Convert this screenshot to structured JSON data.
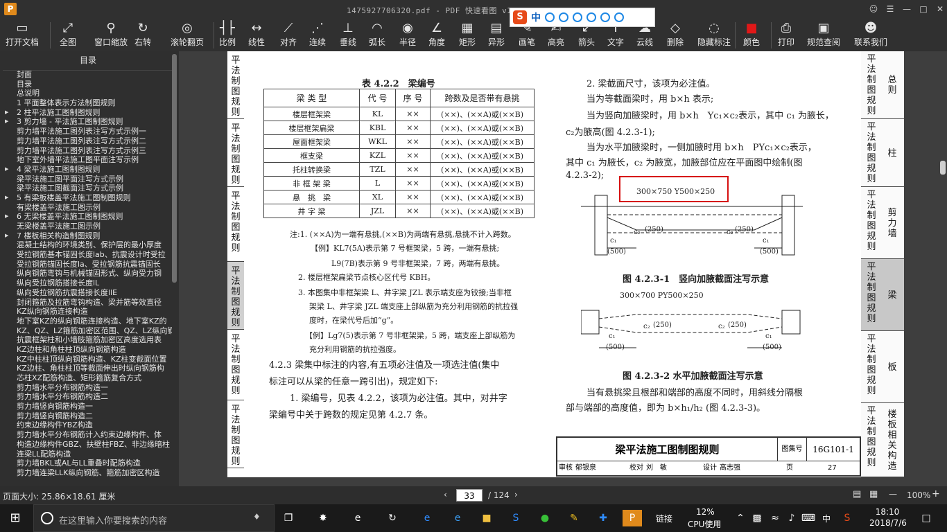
{
  "window": {
    "title": "1475927706320.pdf - PDF 快速看图 v1.8",
    "app_icon": "P"
  },
  "ime": {
    "logo": "S",
    "mode": "中"
  },
  "toolbar": [
    {
      "id": "open",
      "label": "打开文档",
      "icon": "folder-icon"
    },
    {
      "id": "full",
      "label": "全图",
      "icon": "fit-icon"
    },
    {
      "id": "zoomwin",
      "label": "窗口缩放",
      "icon": "zoom-icon"
    },
    {
      "id": "rotate",
      "label": "右转",
      "icon": "rotate-icon"
    },
    {
      "id": "wheel",
      "label": "滚轮翻页",
      "icon": "mouse-icon"
    },
    {
      "id": "ratio",
      "label": "比例",
      "icon": "ruler-icon"
    },
    {
      "id": "linear",
      "label": "线性",
      "icon": "linear-icon"
    },
    {
      "id": "align",
      "label": "对齐",
      "icon": "align-icon"
    },
    {
      "id": "chain",
      "label": "连续",
      "icon": "chain-icon"
    },
    {
      "id": "perp",
      "label": "垂线",
      "icon": "perp-icon"
    },
    {
      "id": "arc",
      "label": "弧长",
      "icon": "arc-icon"
    },
    {
      "id": "radius",
      "label": "半径",
      "icon": "radius-icon"
    },
    {
      "id": "angle",
      "label": "角度",
      "icon": "angle-icon"
    },
    {
      "id": "rect",
      "label": "矩形",
      "icon": "rect-icon"
    },
    {
      "id": "shape",
      "label": "异形",
      "icon": "shape-icon"
    },
    {
      "id": "pen",
      "label": "画笔",
      "icon": "pen-icon"
    },
    {
      "id": "high",
      "label": "高亮",
      "icon": "highlight-icon"
    },
    {
      "id": "arrow",
      "label": "箭头",
      "icon": "arrow-icon"
    },
    {
      "id": "text",
      "label": "文字",
      "icon": "text-icon"
    },
    {
      "id": "cloud",
      "label": "云线",
      "icon": "cloud-icon"
    },
    {
      "id": "del",
      "label": "删除",
      "icon": "eraser-icon"
    },
    {
      "id": "hide",
      "label": "隐藏标注",
      "icon": "eye-off-icon"
    },
    {
      "id": "color",
      "label": "颜色",
      "icon": "color-icon",
      "color": "#e01818"
    },
    {
      "id": "print",
      "label": "打印",
      "icon": "printer-icon"
    },
    {
      "id": "spec",
      "label": "规范查阅",
      "icon": "book-icon"
    },
    {
      "id": "contact",
      "label": "联系我们",
      "icon": "user-icon"
    }
  ],
  "sidebar": {
    "title": "目录",
    "items": [
      {
        "t": "封面",
        "a": false
      },
      {
        "t": "目录",
        "a": false
      },
      {
        "t": "总说明",
        "a": false
      },
      {
        "t": "1 平面整体表示方法制图规则",
        "a": false
      },
      {
        "t": "2 柱平法施工图制图规则",
        "a": true
      },
      {
        "t": "3 剪力墙 - 平法施工图制图规则",
        "a": true
      },
      {
        "t": "剪力墙平法施工图列表注写方式示例一",
        "a": false
      },
      {
        "t": "剪力墙平法施工图列表注写方式示例二",
        "a": false
      },
      {
        "t": "剪力墙平法施工图列表注写方式示例三",
        "a": false
      },
      {
        "t": "地下室外墙平法施工图平面注写示例",
        "a": false
      },
      {
        "t": "4 梁平法施工图制图规则",
        "a": true
      },
      {
        "t": "梁平法施工图平面注写方式示例",
        "a": false
      },
      {
        "t": "梁平法施工图截面注写方式示例",
        "a": false
      },
      {
        "t": "5 有梁板楼盖平法施工图制图规则",
        "a": true
      },
      {
        "t": "有梁楼盖平法施工图示例",
        "a": false
      },
      {
        "t": "6 无梁楼盖平法施工图制图规则",
        "a": true
      },
      {
        "t": "无梁楼盖平法施工图示例",
        "a": false
      },
      {
        "t": "7 楼板相关构造制图规则",
        "a": true
      },
      {
        "t": "混凝土结构的环境类别、保护层的最小厚度",
        "a": false
      },
      {
        "t": "受拉钢筋基本锚固长度lab、抗震设计时受拉",
        "a": false
      },
      {
        "t": "受拉钢筋锚固长度la、受拉钢筋抗震锚固长",
        "a": false
      },
      {
        "t": "纵向钢筋弯钩与机械锚固形式、纵向受力钢",
        "a": false
      },
      {
        "t": "纵向受拉钢筋搭接长度lL",
        "a": false
      },
      {
        "t": "纵向受拉钢筋抗震搭接长度llE",
        "a": false
      },
      {
        "t": "封闭箍筋及拉筋弯钩构造、梁并筋等效直径",
        "a": false
      },
      {
        "t": "KZ纵向钢筋连接构造",
        "a": false
      },
      {
        "t": "地下室KZ的纵向钢筋连接构造、地下室KZ的",
        "a": false
      },
      {
        "t": "KZ、QZ、LZ箍筋加密区范围、QZ、LZ纵向钢筋",
        "a": false
      },
      {
        "t": "抗震框架柱和小墙肢箍筋加密区高度选用表",
        "a": false
      },
      {
        "t": "KZ边柱和角柱柱顶纵向钢筋构造",
        "a": false
      },
      {
        "t": "KZ中柱柱顶纵向钢筋构造、KZ柱变截面位置",
        "a": false
      },
      {
        "t": "KZ边柱、角柱柱顶等截面伸出时纵向钢筋构",
        "a": false
      },
      {
        "t": "芯柱XZ配筋构造、矩形箍筋复合方式",
        "a": false
      },
      {
        "t": "剪力墙水平分布钢筋构造一",
        "a": false
      },
      {
        "t": "剪力墙水平分布钢筋构造二",
        "a": false
      },
      {
        "t": "剪力墙竖向钢筋构造一",
        "a": false
      },
      {
        "t": "剪力墙竖向钢筋构造二",
        "a": false
      },
      {
        "t": "约束边缘构件YBZ构造",
        "a": false
      },
      {
        "t": "剪力墙水平分布钢筋计入约束边缘构件、体",
        "a": false
      },
      {
        "t": "构造边缘构件GBZ、扶壁柱FBZ、非边缘暗柱",
        "a": false
      },
      {
        "t": "连梁LL配筋构造",
        "a": false
      },
      {
        "t": "剪力墙BKL或AL与LL重叠时配筋构造",
        "a": false
      },
      {
        "t": "剪力墙连梁LLK纵向钢筋、箍筋加密区构造",
        "a": false
      }
    ]
  },
  "left_tabs": [
    "平法制图规则",
    "平法制图规则",
    "平法制图规则",
    "平法制图规则",
    "平法制图规则",
    "平法制图规则"
  ],
  "right_tabs": [
    {
      "a": "平法制图规则",
      "b": "总则"
    },
    {
      "a": "平法制图规则",
      "b": "柱"
    },
    {
      "a": "平法制图规则",
      "b": "剪力墙"
    },
    {
      "a": "平法制图规则",
      "b": "梁"
    },
    {
      "a": "平法制图规则",
      "b": "板"
    },
    {
      "a": "平法制图规则",
      "b": "楼板相关构造"
    }
  ],
  "doc": {
    "table_title": "表 4.2.2　梁编号",
    "headers": [
      "梁 类 型",
      "代 号",
      "序 号",
      "跨数及是否带有悬挑"
    ],
    "rows": [
      [
        "楼层框架梁",
        "KL",
        "××",
        "(××)、(××A)或(××B)"
      ],
      [
        "楼层框架扁梁",
        "KBL",
        "××",
        "(××)、(××A)或(××B)"
      ],
      [
        "屋面框架梁",
        "WKL",
        "××",
        "(××)、(××A)或(××B)"
      ],
      [
        "框支梁",
        "KZL",
        "××",
        "(××)、(××A)或(××B)"
      ],
      [
        "托柱转换梁",
        "TZL",
        "××",
        "(××)、(××A)或(××B)"
      ],
      [
        "非 框 架 梁",
        "L",
        "××",
        "(××)、(××A)或(××B)"
      ],
      [
        "悬　挑　梁",
        "XL",
        "××",
        "(××)、(××A)或(××B)"
      ],
      [
        "井 字 梁",
        "JZL",
        "××",
        "(××)、(××A)或(××B)"
      ]
    ],
    "note1": "注:1. (××A)为一端有悬挑,(××B)为两端有悬挑,悬挑不计入跨数。",
    "ex1": "【例】KL7(5A)表示第 7 号框架梁，5 跨，一端有悬挑;",
    "ex2": "L9(7B)表示第 9 号非框架梁，7 跨，两端有悬挑。",
    "note2": "2. 楼层框架扁梁节点核心区代号 KBH。",
    "note3a": "3. 本图集中非框架梁 L、井字梁 JZL 表示端支座为铰接;当非框",
    "note3b": "架梁 L、井字梁 JZL 端支座上部纵筋为充分利用钢筋的抗拉强",
    "note3c": "度时，在梁代号后加“g”。",
    "ex3a": "【例】Lg7(5)表示第 7 号非框架梁，5 跨，端支座上部纵筋为",
    "ex3b": "充分利用钢筋的抗拉强度。",
    "s423a": "4.2.3 梁集中标注的内容,有五项必注值及一项选注值(集中",
    "s423b": "标注可以从梁的任意一跨引出)，规定如下:",
    "s423c": "1. 梁编号，见表 4.2.2，该项为必注值。其中，对井字",
    "s423d": "梁编号中关于跨数的规定见第 4.2.7 条。",
    "r1": "2. 梁截面尺寸，该项为必注值。",
    "r2": "当为等截面梁时，用 b×h 表示;",
    "r3": "当为竖向加腋梁时，用 b×h　Yc₁×c₂表示，其中 c₁ 为腋长，",
    "r4": "c₂为腋高(图 4.2.3-1);",
    "r5": "当为水平加腋梁时，一侧加腋时用 b×h　PYc₁×c₂表示，",
    "r6": "其中 c₁ 为腋长，c₂ 为腋宽，加腋部位应在平面图中绘制(图",
    "r7": "4.2.3-2);",
    "fig1_label": "300×750 Y500×250",
    "fig1_caption": "图 4.2.3-1　竖向加腋截面注写示意",
    "fig2_label": "300×700 PY500×250",
    "fig2_caption": "图 4.2.3-2 水平加腋截面注写示意",
    "dim_c1": "c₁",
    "dim_500": "(500)",
    "dim_c2": "c₂",
    "dim_250": "(250)",
    "r8": "当有悬挑梁且根部和端部的高度不同时，用斜线分隔根",
    "r9": "部与端部的高度值，即为 b×h₁/h₂ (图 4.2.3-3)。",
    "tb_title": "梁平法施工图制图规则",
    "tb_atlas_label": "图集号",
    "tb_atlas": "16G101-1",
    "tb_review": "审核",
    "tb_reviewer": "郁银泉",
    "tb_check": "校对",
    "tb_checker": "刘　敏",
    "tb_design": "设计",
    "tb_designer": "高志强",
    "tb_page_label": "页",
    "tb_page": "27"
  },
  "status": {
    "page_size": "页面大小: 25.86×18.61 厘米",
    "current_page": "33",
    "total_pages": "/ 124",
    "zoom": "100%"
  },
  "taskbar": {
    "search_placeholder": "在这里输入你要搜索的内容",
    "link": "链接",
    "cpu_pct": "12%",
    "cpu_label": "CPU使用",
    "ime": "中",
    "time": "18:10",
    "date": "2018/7/6"
  }
}
